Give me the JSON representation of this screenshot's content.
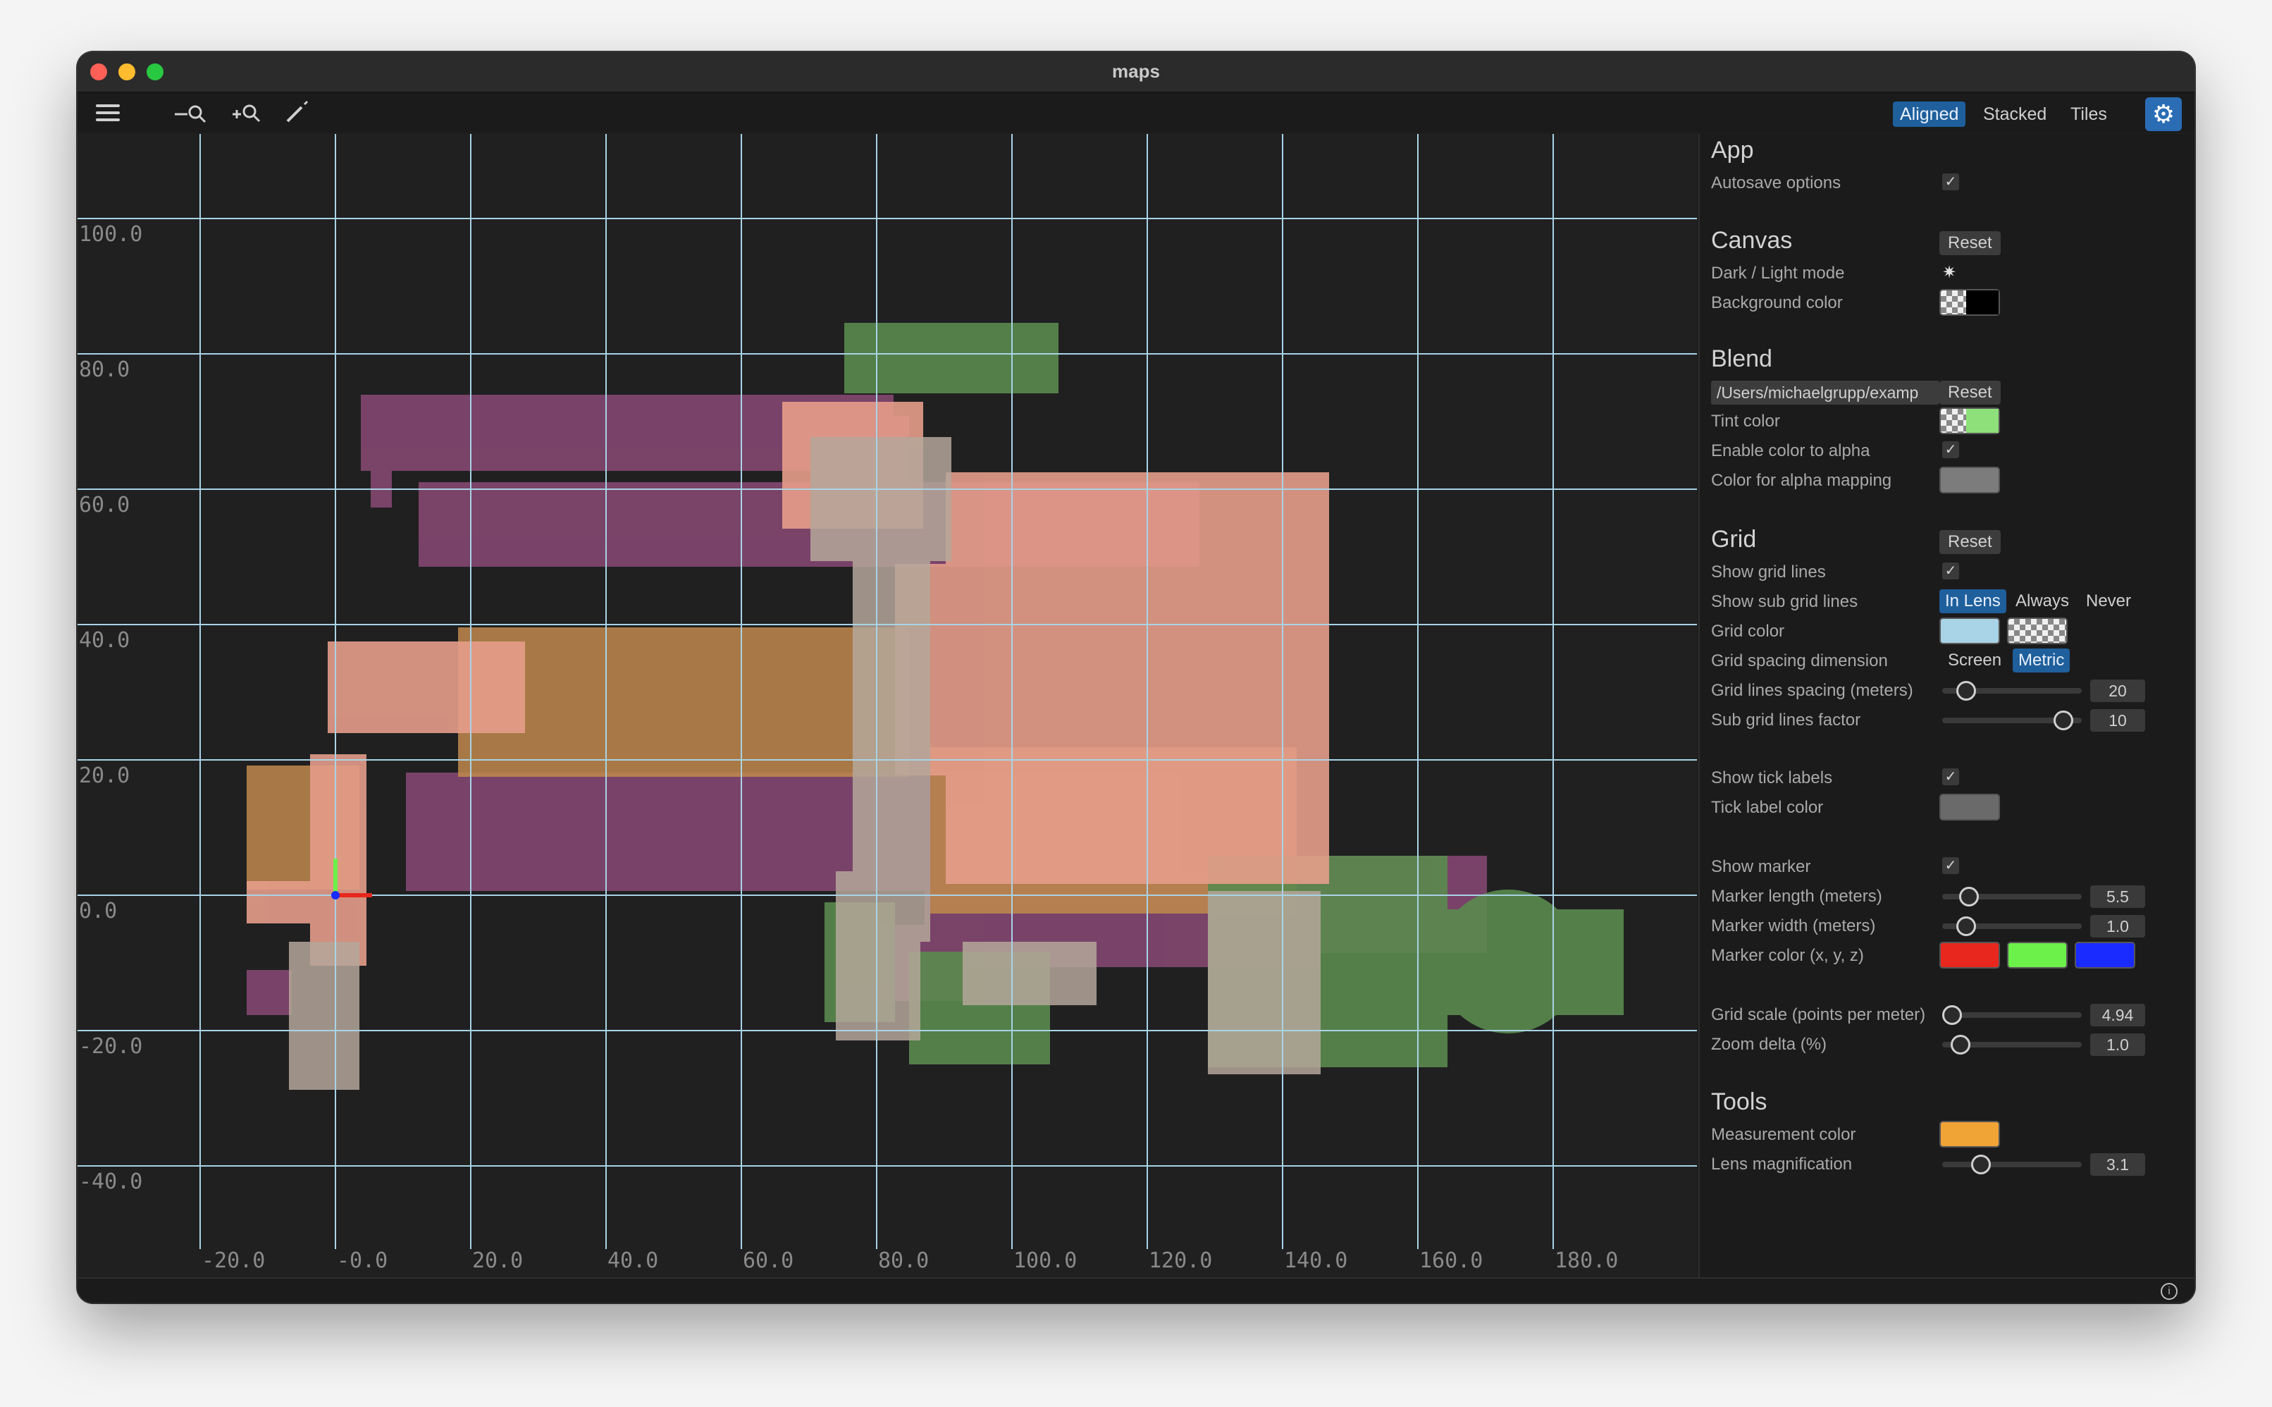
{
  "window": {
    "title": "maps"
  },
  "toolbar": {
    "menu_icon": "hamburger-menu-icon",
    "measure_icon": "measure-zoom-icon",
    "zoom_icon": "zoom-in-icon",
    "pencil_icon": "pencil-icon",
    "view_modes": [
      "Aligned",
      "Stacked",
      "Tiles"
    ],
    "active_view_mode": "Aligned",
    "settings_icon": "gear-icon"
  },
  "canvas": {
    "x_ticks": [
      "-20.0",
      "-0.0",
      "20.0",
      "40.0",
      "60.0",
      "80.0",
      "100.0",
      "120.0",
      "140.0",
      "160.0",
      "180.0"
    ],
    "y_ticks": [
      "100.0",
      "80.0",
      "60.0",
      "40.0",
      "20.0",
      "0.0",
      "-20.0",
      "-40.0"
    ],
    "grid_color": "#a9d3e6",
    "marker_colors": {
      "x": "#e8281e",
      "y": "#6cf04a",
      "z": "#1a2bff"
    }
  },
  "panel": {
    "app": {
      "title": "App",
      "autosave_label": "Autosave options",
      "autosave_checked": "✓"
    },
    "canvas": {
      "title": "Canvas",
      "reset": "Reset",
      "dark_light_label": "Dark / Light mode",
      "dark_light_icon": "✷",
      "background_label": "Background color",
      "background_color": "#000000"
    },
    "blend": {
      "title": "Blend",
      "path": "/Users/michaelgrupp/examp",
      "reset": "Reset",
      "tint_label": "Tint color",
      "tint_color": "#8ee07a",
      "color_to_alpha_label": "Enable color to alpha",
      "color_to_alpha_checked": "✓",
      "alpha_mapping_label": "Color for alpha mapping",
      "alpha_mapping_color": "#7c7c7c"
    },
    "grid": {
      "title": "Grid",
      "reset": "Reset",
      "show_lines_label": "Show grid lines",
      "show_lines_checked": "✓",
      "sub_lines_label": "Show sub grid lines",
      "sub_line_options": [
        "In Lens",
        "Always",
        "Never"
      ],
      "sub_line_active": "In Lens",
      "grid_color_label": "Grid color",
      "grid_color": "#a9d3e6",
      "spacing_dim_label": "Grid spacing dimension",
      "spacing_dim_options": [
        "Screen",
        "Metric"
      ],
      "spacing_dim_active": "Metric",
      "spacing_label": "Grid lines spacing (meters)",
      "spacing_value": "20",
      "spacing_fraction": 0.12,
      "sub_factor_label": "Sub grid lines factor",
      "sub_factor_value": "10",
      "sub_factor_fraction": 0.93,
      "tick_labels_label": "Show tick labels",
      "tick_labels_checked": "✓",
      "tick_color_label": "Tick label color",
      "tick_color": "#6a6a6a",
      "marker_label": "Show marker",
      "marker_checked": "✓",
      "marker_length_label": "Marker length (meters)",
      "marker_length_value": "5.5",
      "marker_length_fraction": 0.14,
      "marker_width_label": "Marker width (meters)",
      "marker_width_value": "1.0",
      "marker_width_fraction": 0.12,
      "marker_color_label": "Marker color (x, y, z)",
      "marker_colors": [
        "#e8281e",
        "#6cf04a",
        "#1a2bff"
      ],
      "scale_label": "Grid scale (points per meter)",
      "scale_value": "4.94",
      "scale_fraction": 0.0,
      "zoom_delta_label": "Zoom delta (%)",
      "zoom_delta_value": "1.0",
      "zoom_delta_fraction": 0.07
    },
    "tools": {
      "title": "Tools",
      "measurement_label": "Measurement color",
      "measurement_color": "#f0a436",
      "lens_label": "Lens magnification",
      "lens_value": "3.1",
      "lens_fraction": 0.24
    }
  },
  "status": {
    "info_icon": "info-icon",
    "info_glyph": "i"
  }
}
